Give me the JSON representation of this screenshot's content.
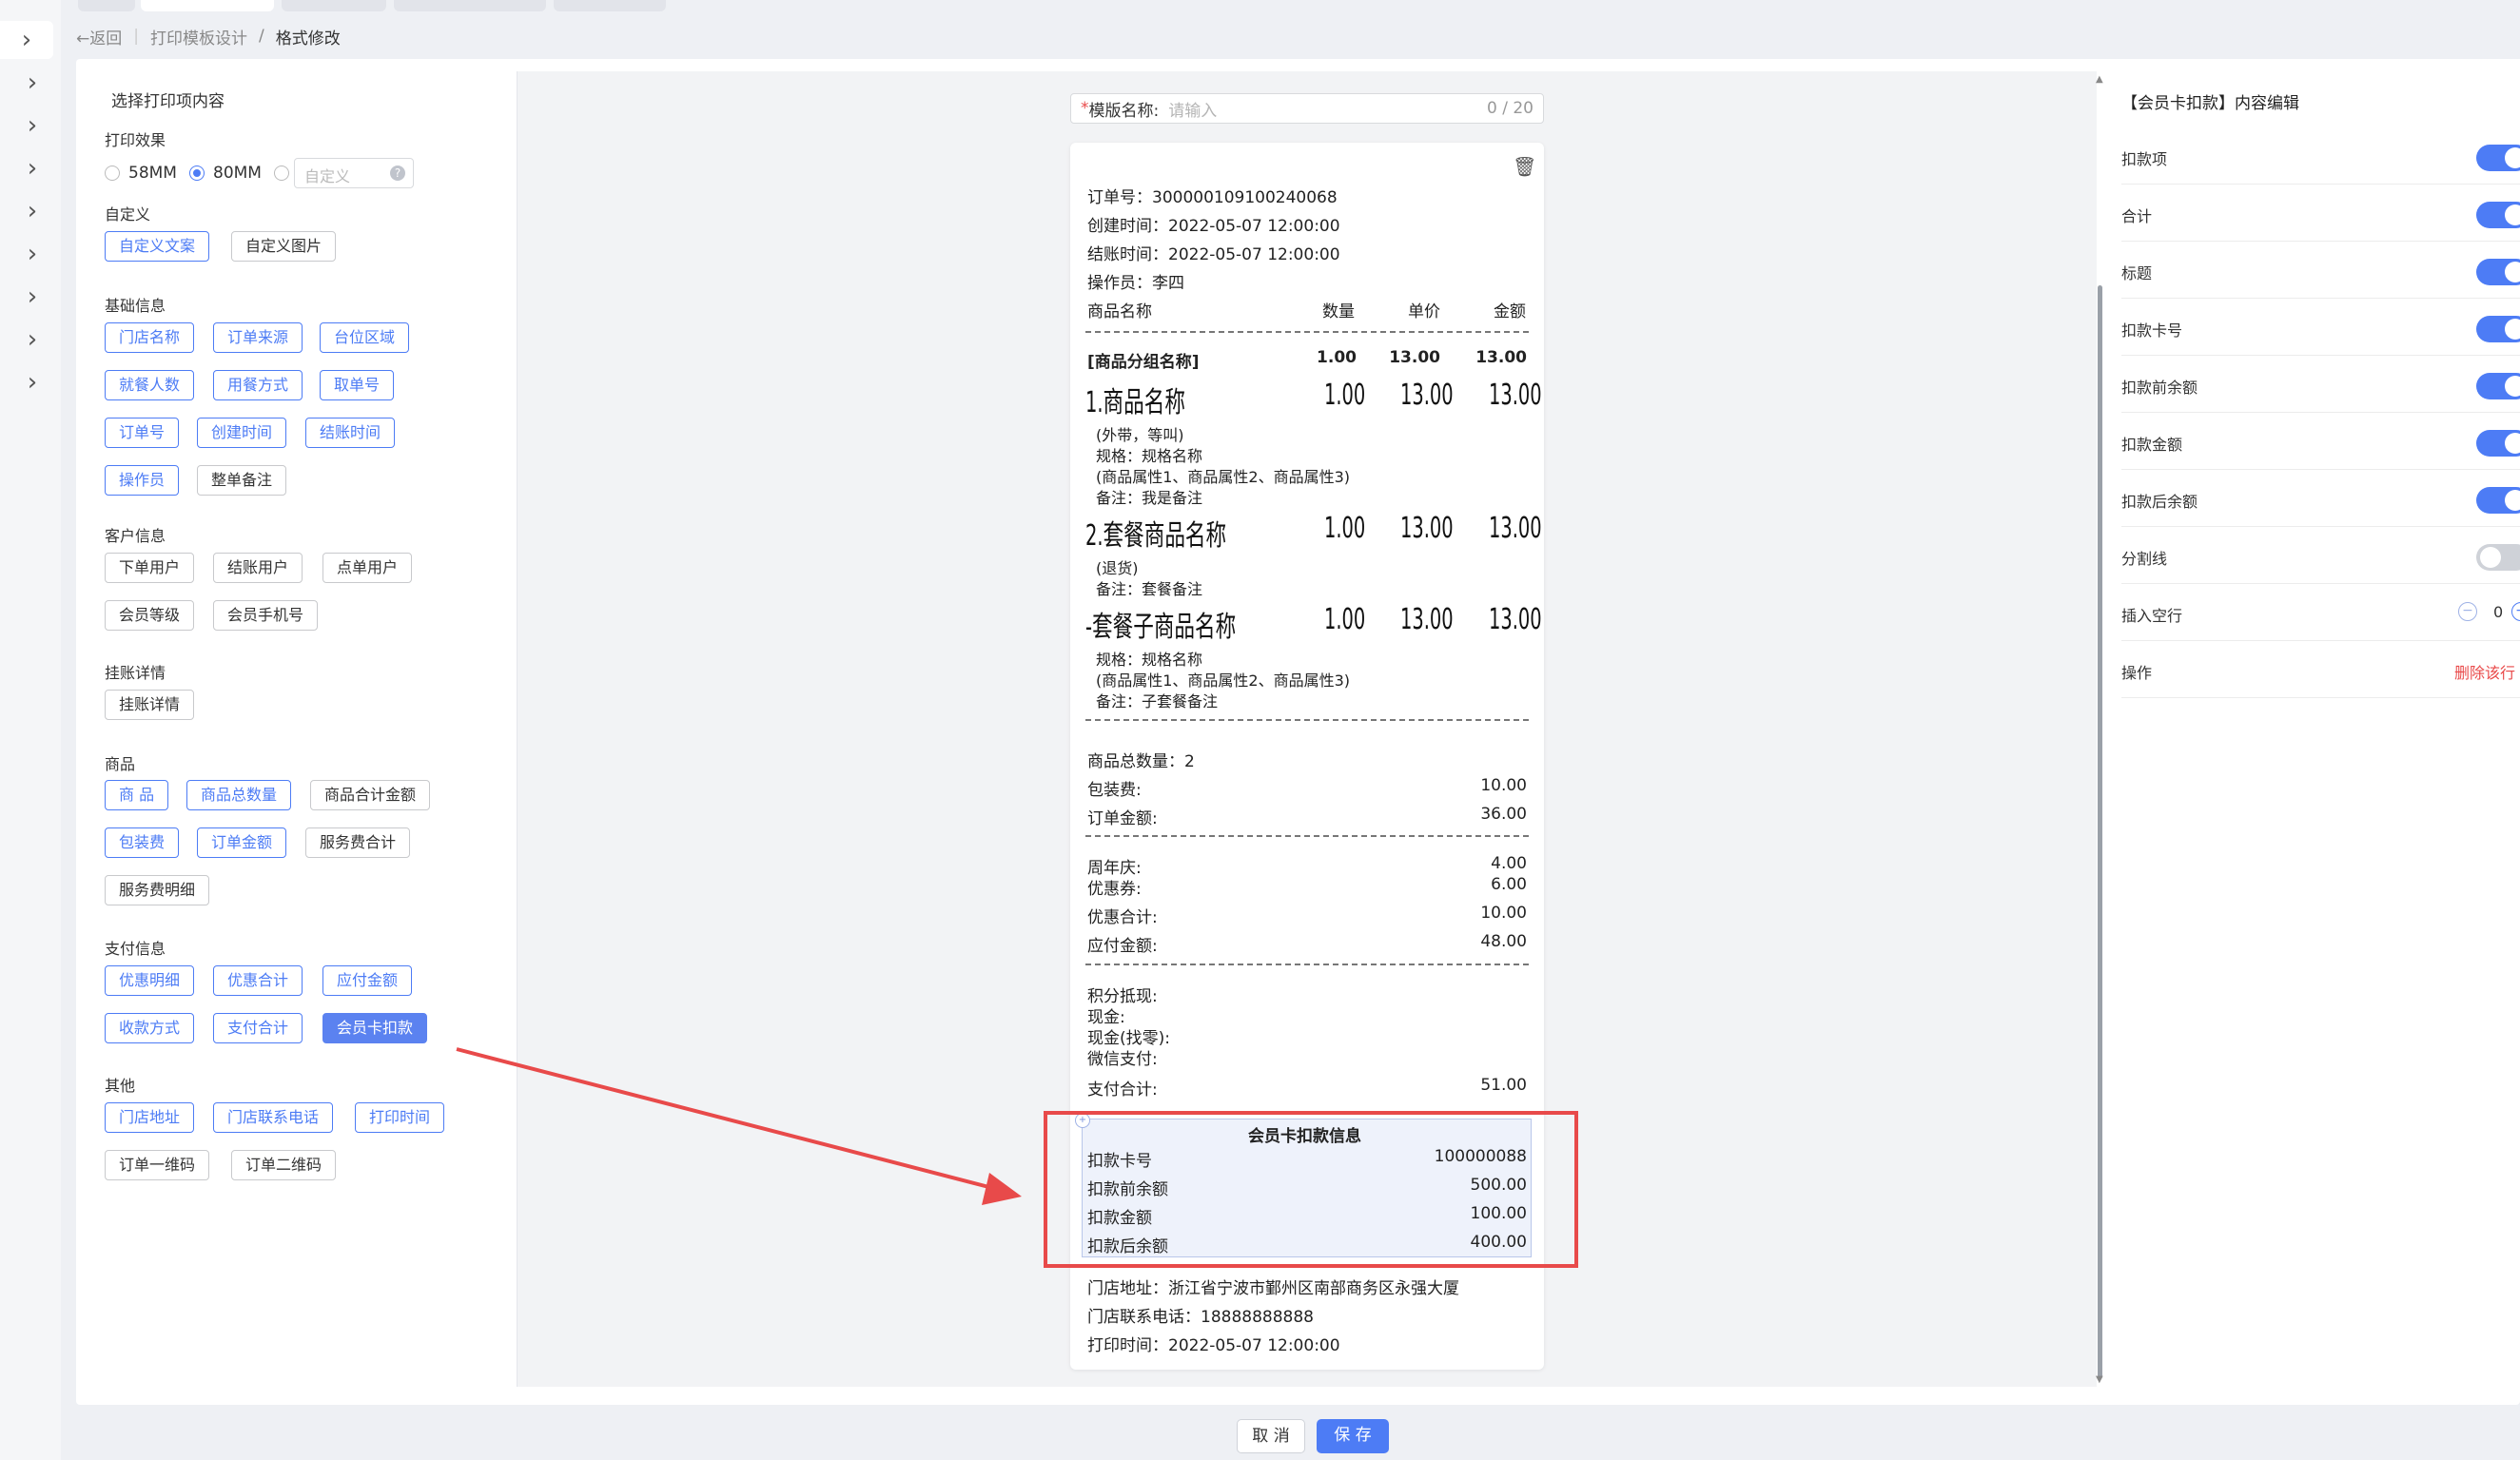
{
  "breadcrumb": {
    "back": "返回",
    "parent": "打印模板设计",
    "separator": "/",
    "current": "格式修改"
  },
  "left": {
    "title": "选择打印项内容",
    "print_effect": {
      "label": "打印效果",
      "options": [
        "58MM",
        "80MM"
      ],
      "selected": "80MM",
      "custom_placeholder": "自定义",
      "help": "?"
    },
    "custom": {
      "label": "自定义",
      "tags": [
        "自定义文案",
        "自定义图片"
      ]
    },
    "basic": {
      "label": "基础信息",
      "tags": [
        "门店名称",
        "订单来源",
        "台位区域",
        "就餐人数",
        "用餐方式",
        "取单号",
        "订单号",
        "创建时间",
        "结账时间",
        "操作员",
        "整单备注"
      ]
    },
    "customer": {
      "label": "客户信息",
      "tags": [
        "下单用户",
        "结账用户",
        "点单用户",
        "会员等级",
        "会员手机号"
      ]
    },
    "credit": {
      "label": "挂账详情",
      "tags": [
        "挂账详情"
      ]
    },
    "goods": {
      "label": "商品",
      "tags": [
        "商 品",
        "商品总数量",
        "商品合计金额",
        "包装费",
        "订单金额",
        "服务费合计",
        "服务费明细"
      ]
    },
    "payment": {
      "label": "支付信息",
      "tags": [
        "优惠明细",
        "优惠合计",
        "应付金额",
        "收款方式",
        "支付合计",
        "会员卡扣款"
      ]
    },
    "other": {
      "label": "其他",
      "tags": [
        "门店地址",
        "门店联系电话",
        "打印时间",
        "订单一维码",
        "订单二维码"
      ]
    }
  },
  "template_name": {
    "required_mark": "*",
    "label": "模版名称:",
    "placeholder": "请输入",
    "counter": "0 / 20"
  },
  "receipt": {
    "order_no": "订单号：300000109100240068",
    "created": "创建时间：2022-05-07 12:00:00",
    "settled": "结账时间：2022-05-07 12:00:00",
    "operator": "操作员：李四",
    "header": [
      "商品名称",
      "数量",
      "单价",
      "金额"
    ],
    "group": {
      "name": "[商品分组名称]",
      "qty": "1.00",
      "price": "13.00",
      "amount": "13.00"
    },
    "item1": {
      "name": "1.商品名称",
      "qty": "1.00",
      "price": "13.00",
      "amount": "13.00",
      "lines": [
        "(外带，等叫)",
        "规格：规格名称",
        "(商品属性1、商品属性2、商品属性3)",
        "备注：我是备注"
      ]
    },
    "item2": {
      "name": "2.套餐商品名称",
      "qty": "1.00",
      "price": "13.00",
      "amount": "13.00",
      "lines": [
        "(退货)",
        "备注：套餐备注"
      ]
    },
    "item3": {
      "name": "-套餐子商品名称",
      "qty": "1.00",
      "price": "13.00",
      "amount": "13.00",
      "lines": [
        "规格：规格名称",
        "(商品属性1、商品属性2、商品属性3)",
        "备注：子套餐备注"
      ]
    },
    "total_qty": "商品总数量：2",
    "packing": {
      "label": "包装费:",
      "value": "10.00"
    },
    "order_amount": {
      "label": "订单金额:",
      "value": "36.00"
    },
    "anniversary": {
      "label": "周年庆:",
      "value": "4.00"
    },
    "coupon": {
      "label": "优惠券:",
      "value": "6.00"
    },
    "discount_total": {
      "label": "优惠合计:",
      "value": "10.00"
    },
    "payable": {
      "label": "应付金额:",
      "value": "48.00"
    },
    "points": "积分抵现:",
    "cash": "现金:",
    "change": "现金(找零):",
    "wechat": "微信支付:",
    "pay_total": {
      "label": "支付合计:",
      "value": "51.00"
    },
    "member": {
      "title": "会员卡扣款信息",
      "rows": [
        {
          "label": "扣款卡号",
          "value": "100000088"
        },
        {
          "label": "扣款前余额",
          "value": "500.00"
        },
        {
          "label": "扣款金额",
          "value": "100.00"
        },
        {
          "label": "扣款后余额",
          "value": "400.00"
        }
      ]
    },
    "address": "门店地址：浙江省宁波市鄞州区南部商务区永强大厦",
    "phone": "门店联系电话：18888888888",
    "print_time": "打印时间：2022-05-07 12:00:00"
  },
  "right": {
    "title": "【会员卡扣款】内容编辑",
    "rows": [
      {
        "label": "扣款项",
        "on": true
      },
      {
        "label": "合计",
        "on": true
      },
      {
        "label": "标题",
        "on": true
      },
      {
        "label": "扣款卡号",
        "on": true
      },
      {
        "label": "扣款前余额",
        "on": true
      },
      {
        "label": "扣款金额",
        "on": true
      },
      {
        "label": "扣款后余额",
        "on": true
      },
      {
        "label": "分割线",
        "on": false
      }
    ],
    "blank_lines": {
      "label": "插入空行",
      "value": "0"
    },
    "operation": {
      "label": "操作",
      "action": "删除该行"
    }
  },
  "footer": {
    "cancel": "取 消",
    "save": "保 存"
  },
  "colors": {
    "accent": "#4d7cf5",
    "highlight": "#e84a4a",
    "danger": "#e94a4a"
  }
}
